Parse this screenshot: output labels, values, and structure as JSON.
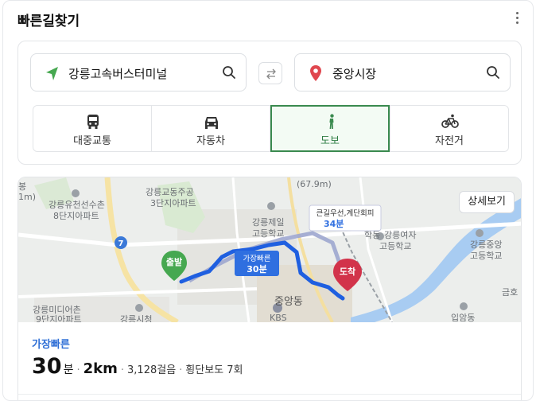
{
  "header": {
    "title": "빠른길찾기"
  },
  "search": {
    "origin": "강릉고속버스터미널",
    "destination": "중앙시장"
  },
  "modes": [
    {
      "label": "대중교통",
      "icon": "bus-icon",
      "active": false
    },
    {
      "label": "자동차",
      "icon": "car-icon",
      "active": false
    },
    {
      "label": "도보",
      "icon": "walk-icon",
      "active": true
    },
    {
      "label": "자전거",
      "icon": "bicycle-icon",
      "active": false
    }
  ],
  "map": {
    "detail_button": "상세보기",
    "labels": {
      "l1": "강릉유천선수촌",
      "l2": "8단지아파트",
      "l3": "강릉교동주공",
      "l4": "3단지아파트",
      "l5": "(67.9m)",
      "l6": "강릉제일",
      "l7": "고등학교",
      "l8": "강릉여자",
      "l9": "고등학교",
      "l10": "강릉중앙",
      "l11": "고등학교",
      "l12": "강릉미디어촌",
      "l13": "9단지아파트",
      "l14": "강릉시청",
      "l15": "중앙동",
      "l16": "KBS",
      "l17": "입암동",
      "l18": "금호",
      "l19": "학동",
      "l20": "봉",
      "l21": "1m)",
      "road": "7"
    },
    "start_marker": "출발",
    "end_marker": "도착",
    "callout_fast": {
      "line1": "가장빠른",
      "line2": "30분"
    },
    "callout_alt": {
      "line1": "큰길우선,계단회피",
      "line2": "34분"
    }
  },
  "result": {
    "tag": "가장빠른",
    "minutes": "30",
    "minutes_unit": "분",
    "distance": "2km",
    "steps": "3,128걸음",
    "crosswalks": "횡단보도 7회"
  },
  "colors": {
    "accent_green": "#3a8a4f",
    "route_blue": "#1f5fe0",
    "alt_route": "#8c96c4",
    "dest_red": "#d2334a",
    "start_green": "#46a850",
    "tag_blue": "#2f6fd6"
  }
}
